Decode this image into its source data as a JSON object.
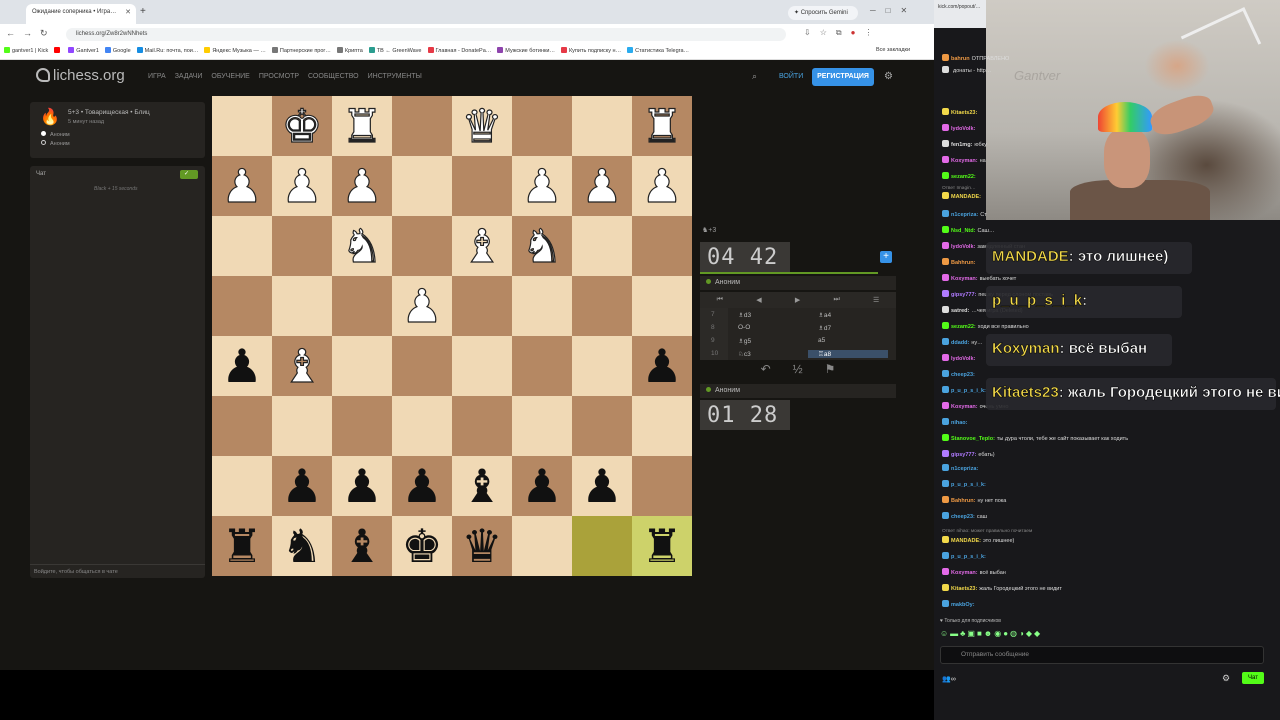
{
  "browser": {
    "tab_title": "Ожидание соперника • Игра…",
    "new_tab": "+",
    "url": "lichess.org/Zw8r2wNNhets",
    "gemini": "✦ Спросить Gemini",
    "bookmarks": [
      {
        "label": "gantver1 | Kick",
        "color": "#53fc18"
      },
      {
        "label": "",
        "color": "#ff0000"
      },
      {
        "label": "Gantver1",
        "color": "#9146ff"
      },
      {
        "label": "Google",
        "color": "#4285f4"
      },
      {
        "label": "Mail.Ru: почта, пои…",
        "color": "#168de2"
      },
      {
        "label": "Яндекс Музыка — …",
        "color": "#ffcc00"
      },
      {
        "label": "Партнерские прог…",
        "color": "#777777"
      },
      {
        "label": "Крипта",
        "color": "#777777"
      },
      {
        "label": "TB ← GreenWave",
        "color": "#2a9d8f"
      },
      {
        "label": "Главная - DonatePa…",
        "color": "#e63946"
      },
      {
        "label": "Мужские ботинки…",
        "color": "#8e44ad"
      },
      {
        "label": "Купить подписку н…",
        "color": "#e63946"
      },
      {
        "label": "Статистика Telegra…",
        "color": "#2aabee"
      }
    ],
    "all_bookmarks": "Все закладки"
  },
  "lichess": {
    "logo": "lichess.org",
    "nav": [
      "ИГРА",
      "ЗАДАЧИ",
      "ОБУЧЕНИЕ",
      "ПРОСМОТР",
      "СООБЩЕСТВО",
      "ИНСТРУМЕНТЫ"
    ],
    "login": "ВОЙТИ",
    "signup": "РЕГИСТРАЦИЯ",
    "game_desc": "5+3 • Товарищеская • Блиц",
    "game_time": "5 минут назад",
    "player_white": "Аноним",
    "player_black": "Аноним",
    "chat_title": "Чат",
    "chat_note": "Black + 15 seconds",
    "chat_input_placeholder": "Войдите, чтобы общаться в чате",
    "board": [
      [
        "",
        "wK",
        "wR",
        "",
        "wQ",
        "",
        "",
        "wR"
      ],
      [
        "wP",
        "wP",
        "wP",
        "",
        "",
        "wP",
        "wP",
        "wP"
      ],
      [
        "",
        "",
        "wN",
        "",
        "wB",
        "wN",
        "",
        ""
      ],
      [
        "",
        "",
        "",
        "wP",
        "",
        "",
        "",
        ""
      ],
      [
        "bP",
        "wB",
        "",
        "",
        "",
        "",
        "",
        "bP"
      ],
      [
        "",
        "",
        "",
        "",
        "",
        "",
        "",
        ""
      ],
      [
        "",
        "bP",
        "bP",
        "bP",
        "bB",
        "bP",
        "bP",
        ""
      ],
      [
        "bR",
        "bN",
        "bB",
        "bK",
        "bQ",
        "",
        "",
        "bR"
      ]
    ],
    "highlight": [
      [
        7,
        6
      ],
      [
        7,
        7
      ]
    ],
    "opp_header": "+3",
    "clock_top": "04 42",
    "clock_bottom": "01 28",
    "top_player": "Аноним",
    "bottom_player": "Аноним",
    "moves": [
      {
        "n": "7",
        "w": "♗d3",
        "b": "♗a4"
      },
      {
        "n": "8",
        "w": "O-O",
        "b": "♗d7"
      },
      {
        "n": "9",
        "w": "♗g5",
        "b": "a5"
      },
      {
        "n": "10",
        "w": "♘c3",
        "b": "♖a8"
      }
    ]
  },
  "stream": {
    "kick_tab": "kick.com/popout/…",
    "cam_text": "Gantver",
    "chat": [
      {
        "user": "bahrun",
        "text": "ОТПРАВЛЕНО",
        "color": "#e94"
      },
      {
        "user": "",
        "text": "донаты - http…",
        "color": "#ddd"
      },
      {
        "user": "Kitaets23:",
        "text": "",
        "color": "#f2d94a"
      },
      {
        "user": "lydoVolk:",
        "text": "",
        "color": "#e36ae8"
      },
      {
        "user": "fen1mg:",
        "text": "юбку",
        "color": "#ddd"
      },
      {
        "user": "Koxyman:",
        "text": "на",
        "color": "#e36ae8"
      },
      {
        "user": "sezam22:",
        "text": "",
        "color": "#53fc18"
      },
      {
        "user": "MANDADE:",
        "text": "",
        "color": "#f2d94a"
      },
      {
        "user": "n1cepriza:",
        "text": "Ст",
        "color": "#4aa3df"
      },
      {
        "user": "Nsd_Ntd:",
        "text": "Саш…",
        "color": "#53fc18"
      },
      {
        "user": "lydoVolk:",
        "text": "замедленный стан",
        "color": "#e36ae8"
      },
      {
        "user": "Bahhrun:",
        "text": "",
        "color": "#e94"
      },
      {
        "user": "Koxyman:",
        "text": "выебать хочет",
        "color": "#e36ae8"
      },
      {
        "user": "gipsy777:",
        "text": "пешку перед слоном поставь",
        "color": "#b07bff"
      },
      {
        "user": "satred:",
        "text": "…чея игра (Deleted)",
        "color": "#ddd"
      },
      {
        "user": "sezam22:",
        "text": "ходи все правильно",
        "color": "#53fc18"
      },
      {
        "user": "ddadd:",
        "text": "ну…",
        "color": "#4aa3df"
      },
      {
        "user": "lydoVolk:",
        "text": "",
        "color": "#e36ae8"
      },
      {
        "user": "cheep23:",
        "text": "",
        "color": "#4aa3df"
      },
      {
        "user": "p_u_p_s_i_k:",
        "text": "",
        "color": "#4aa3df"
      },
      {
        "user": "Koxyman:",
        "text": "очень умно",
        "color": "#e36ae8"
      },
      {
        "user": "nihao:",
        "text": "",
        "color": "#4aa3df"
      },
      {
        "user": "Stanovoe_Teplo:",
        "text": "ты дура чтоли, тебе же сайт показывает как ходить",
        "color": "#53fc18"
      },
      {
        "user": "gipsy777:",
        "text": "ебать)",
        "color": "#b07bff"
      },
      {
        "user": "n1cepriza:",
        "text": "",
        "color": "#4aa3df"
      },
      {
        "user": "p_u_p_s_i_k:",
        "text": "",
        "color": "#4aa3df"
      },
      {
        "user": "Bahhrun:",
        "text": "ну нет пока",
        "color": "#e94"
      },
      {
        "user": "cheep23:",
        "text": "саш",
        "color": "#4aa3df"
      },
      {
        "user": "MANDADE:",
        "text": "это лишнее)",
        "color": "#f2d94a"
      },
      {
        "user": "p_u_p_s_i_k:",
        "text": "",
        "color": "#4aa3df"
      },
      {
        "user": "Koxyman:",
        "text": "всё выбан",
        "color": "#e36ae8"
      },
      {
        "user": "Kitaets23:",
        "text": "жаль Городецкий этого не видит",
        "color": "#f2d94a"
      },
      {
        "user": "makbOy:",
        "text": "",
        "color": "#4aa3df"
      }
    ],
    "reply_note_1": "Ответ Imagin…",
    "reply_note_2": "Ответ nihao: может правильно почитаем",
    "overlays": [
      {
        "user": "MANDADE",
        "text": ": это лишнее)"
      },
      {
        "user": "p_u_p_s_i_k",
        "text": ":"
      },
      {
        "user": "Koxyman",
        "text": ": всё выбан"
      },
      {
        "user": "Kitaets23",
        "text": ": жаль Городецкий этого не видит"
      }
    ],
    "subs_only": "♥ Только для подписчиков",
    "send_placeholder": "Отправить сообщение",
    "viewers": "∞",
    "chat_button": "Чат"
  }
}
